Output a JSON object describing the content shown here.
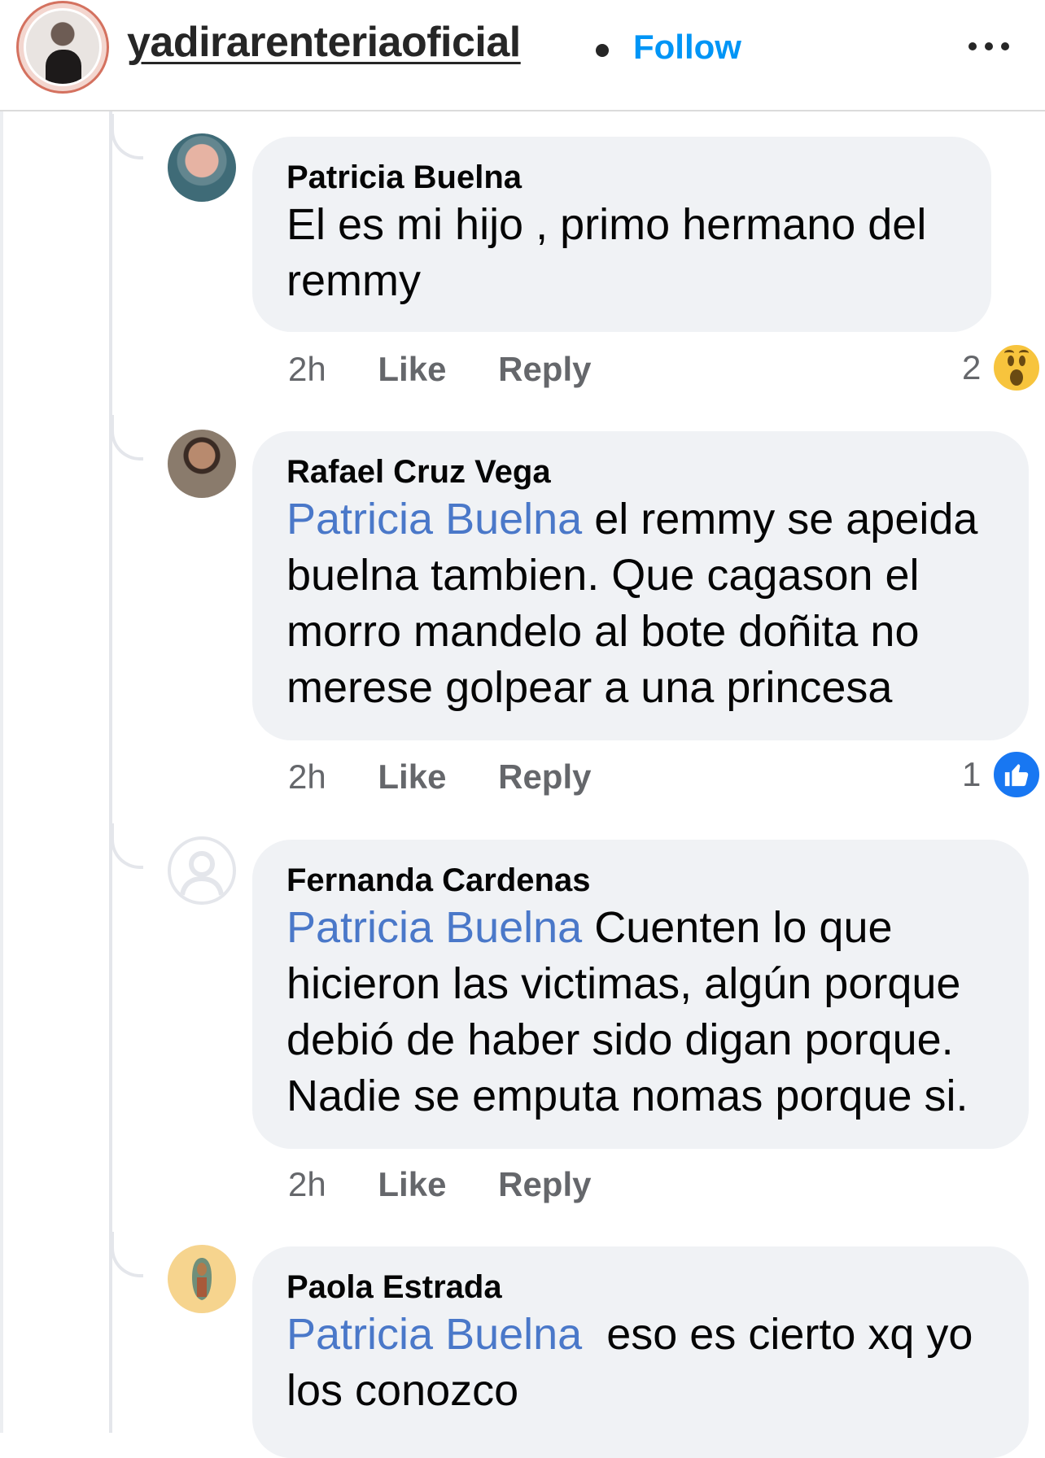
{
  "header": {
    "username": "yadirarenteriaoficial",
    "follow_label": "Follow",
    "colors": {
      "follow": "#0095f6",
      "ring": "#d4715f"
    }
  },
  "comments": [
    {
      "author": "Patricia Buelna",
      "mention": "",
      "text": "El es mi hijo , primo hermano del remmy",
      "time": "2h",
      "like_label": "Like",
      "reply_label": "Reply",
      "reaction_count": "2",
      "reaction_icon": "wow-icon"
    },
    {
      "author": "Rafael Cruz Vega",
      "mention": "Patricia Buelna",
      "text": " el remmy se apeida buelna tambien. Que cagason el morro mandelo al bote doñita no merese golpear a una princesa",
      "time": "2h",
      "like_label": "Like",
      "reply_label": "Reply",
      "reaction_count": "1",
      "reaction_icon": "like-icon"
    },
    {
      "author": "Fernanda Cardenas",
      "mention": "Patricia Buelna",
      "text": " Cuenten lo que hicieron las victimas, algún porque debió de haber sido digan porque. Nadie se emputa nomas porque si.",
      "time": "2h",
      "like_label": "Like",
      "reply_label": "Reply"
    },
    {
      "author": "Paola Estrada",
      "mention": "Patricia Buelna",
      "text": "  eso es cierto xq yo los conozco"
    }
  ],
  "colors": {
    "mention": "#4a78c9",
    "bubble": "#f0f2f5",
    "secondary_text": "#65676b"
  }
}
